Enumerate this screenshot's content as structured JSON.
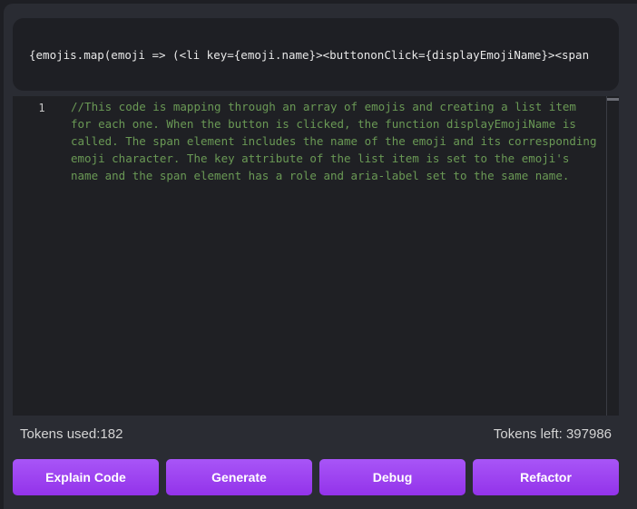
{
  "prompt_input": {
    "value": "{emojis.map(emoji => (<li key={emoji.name}><buttononClick={displayEmojiName}><span"
  },
  "editor": {
    "line_number": "1",
    "content": "//This code is mapping through an array of emojis and creating a list item for each one. When the button is clicked, the function displayEmojiName is called. The span element includes the name of the emoji and its corresponding emoji character. The key attribute of the list item is set to the emoji's name and the span element has a role and aria-label set to the same name."
  },
  "tokens": {
    "used_label": "Tokens used:182",
    "left_label": "Tokens left: 397986"
  },
  "actions": {
    "explain": "Explain Code",
    "generate": "Generate",
    "debug": "Debug",
    "refactor": "Refactor"
  },
  "colors": {
    "accent": "#9333ea",
    "comment": "#6a9955",
    "background": "#2a2c33"
  }
}
